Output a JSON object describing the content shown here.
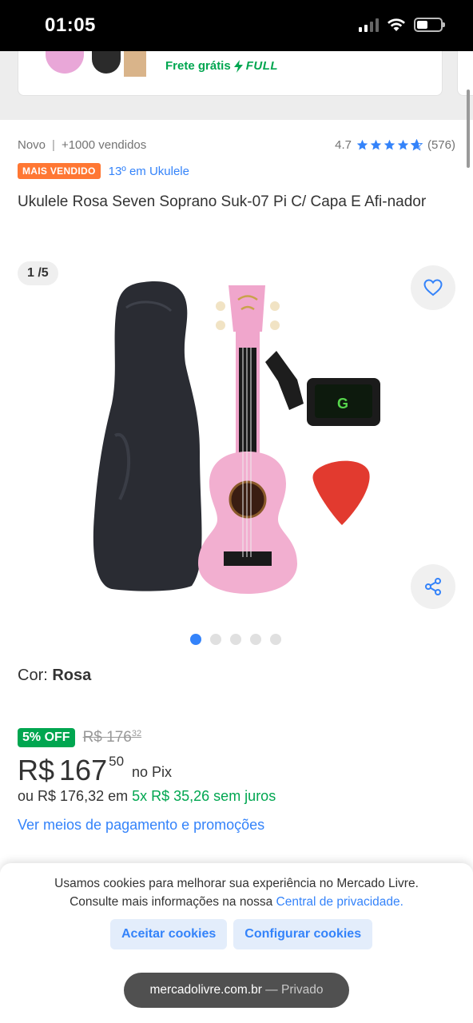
{
  "status_bar": {
    "time": "01:05"
  },
  "top_card": {
    "shipping_label": "Frete grátis",
    "full_label": "FULL"
  },
  "product": {
    "condition": "Novo",
    "sold": "+1000 vendidos",
    "rating": "4.7",
    "rating_stars": 4.7,
    "reviews": "(576)",
    "badge": "MAIS VENDIDO",
    "ranking": "13º em Ukulele",
    "title": "Ukulele Rosa Seven Soprano Suk-07 Pi C/ Capa E Afi-nador"
  },
  "gallery": {
    "counter": "1 /5",
    "total_images": 5,
    "active_image": 1
  },
  "color": {
    "label": "Cor:",
    "value": "Rosa"
  },
  "price": {
    "discount_badge": "5% OFF",
    "old_currency": "R$",
    "old_integer": "176",
    "old_cents": "32",
    "currency": "R$",
    "integer": "167",
    "cents": "50",
    "pix_label": "no Pix",
    "installments_prefix": "ou R$ 176,32 em",
    "installments_value": "5x R$ 35,26 sem juros",
    "payment_link": "Ver meios de pagamento e promoções"
  },
  "cookie_banner": {
    "text_line1": "Usamos cookies para melhorar sua experiência no Mercado Livre.",
    "text_line2": "Consulte mais informações na nossa",
    "privacy_link": "Central de privacidade.",
    "accept_button": "Aceitar cookies",
    "configure_button": "Configurar cookies"
  },
  "browser": {
    "url": "mercadolivre.com.br",
    "mode": "— Privado"
  },
  "colors": {
    "accent_blue": "#3483fa",
    "green": "#00a650",
    "badge_orange": "#ff7733"
  }
}
